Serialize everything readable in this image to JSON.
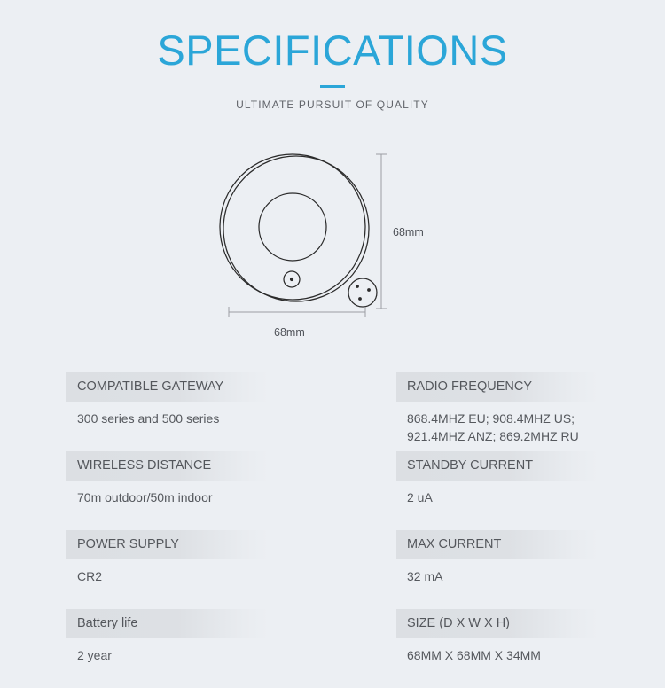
{
  "header": {
    "title": "SPECIFICATIONS",
    "subtitle": "ULTIMATE PURSUIT OF QUALITY",
    "accent_color": "#2ba6d8"
  },
  "diagram": {
    "name": "round-wireless-sensor-outline",
    "width_label": "68mm",
    "height_label": "68mm",
    "line_color": "#2b2b2b"
  },
  "specs": {
    "left_column": [
      {
        "label": "COMPATIBLE GATEWAY",
        "value": "300 series and 500 series"
      },
      {
        "label": "WIRELESS DISTANCE",
        "value": "70m outdoor/50m indoor"
      },
      {
        "label": "POWER SUPPLY",
        "value": "CR2"
      },
      {
        "label": "Battery life",
        "value": "2 year"
      }
    ],
    "right_column": [
      {
        "label": "RADIO FREQUENCY",
        "value": "868.4MHZ EU; 908.4MHZ US;\n921.4MHZ ANZ; 869.2MHZ RU"
      },
      {
        "label": "STANDBY CURRENT",
        "value": "2 uA"
      },
      {
        "label": "MAX CURRENT",
        "value": "32 mA"
      },
      {
        "label": "SIZE (D X W X H)",
        "value": "68MM X 68MM X 34MM"
      }
    ]
  }
}
